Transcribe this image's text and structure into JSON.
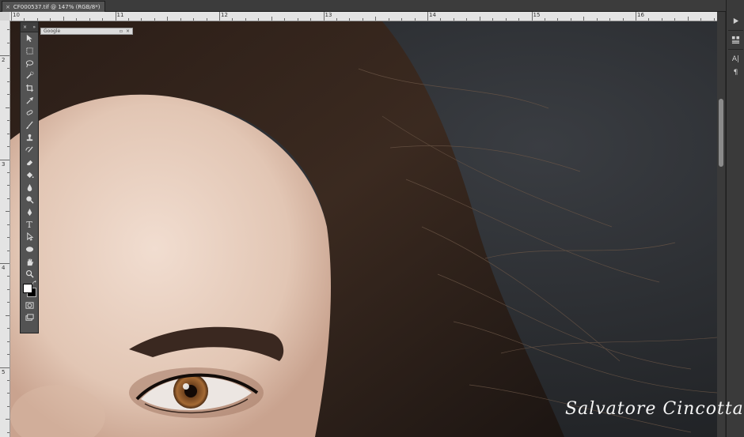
{
  "document": {
    "tab_title": "CF000537.tif @ 147% (RGB/8*)",
    "close_glyph": "×"
  },
  "rulers": {
    "top_labels": [
      "10",
      "11",
      "12",
      "13",
      "14",
      "15",
      "16"
    ],
    "left_labels": [
      "2",
      "3",
      "4",
      "5"
    ]
  },
  "toolbox": {
    "collapse_glyph": "»",
    "close_glyph": "×",
    "tools": [
      "move-tool",
      "marquee-tool",
      "lasso-tool",
      "quick-selection-tool",
      "crop-tool",
      "eyedropper-tool",
      "healing-brush-tool",
      "brush-tool",
      "clone-stamp-tool",
      "history-brush-tool",
      "eraser-tool",
      "paint-bucket-tool",
      "blur-tool",
      "dodge-tool",
      "pen-tool",
      "type-tool",
      "path-selection-tool",
      "ellipse-tool",
      "hand-tool",
      "zoom-tool"
    ],
    "type_glyph": "T",
    "colors": {
      "foreground": "#ffffff",
      "background": "#000000"
    }
  },
  "floating_panel": {
    "title": "Google"
  },
  "dock": {
    "type_glyph": "A|",
    "paragraph_glyph": "¶"
  },
  "watermark": {
    "text": "Salvatore Cincotta"
  }
}
